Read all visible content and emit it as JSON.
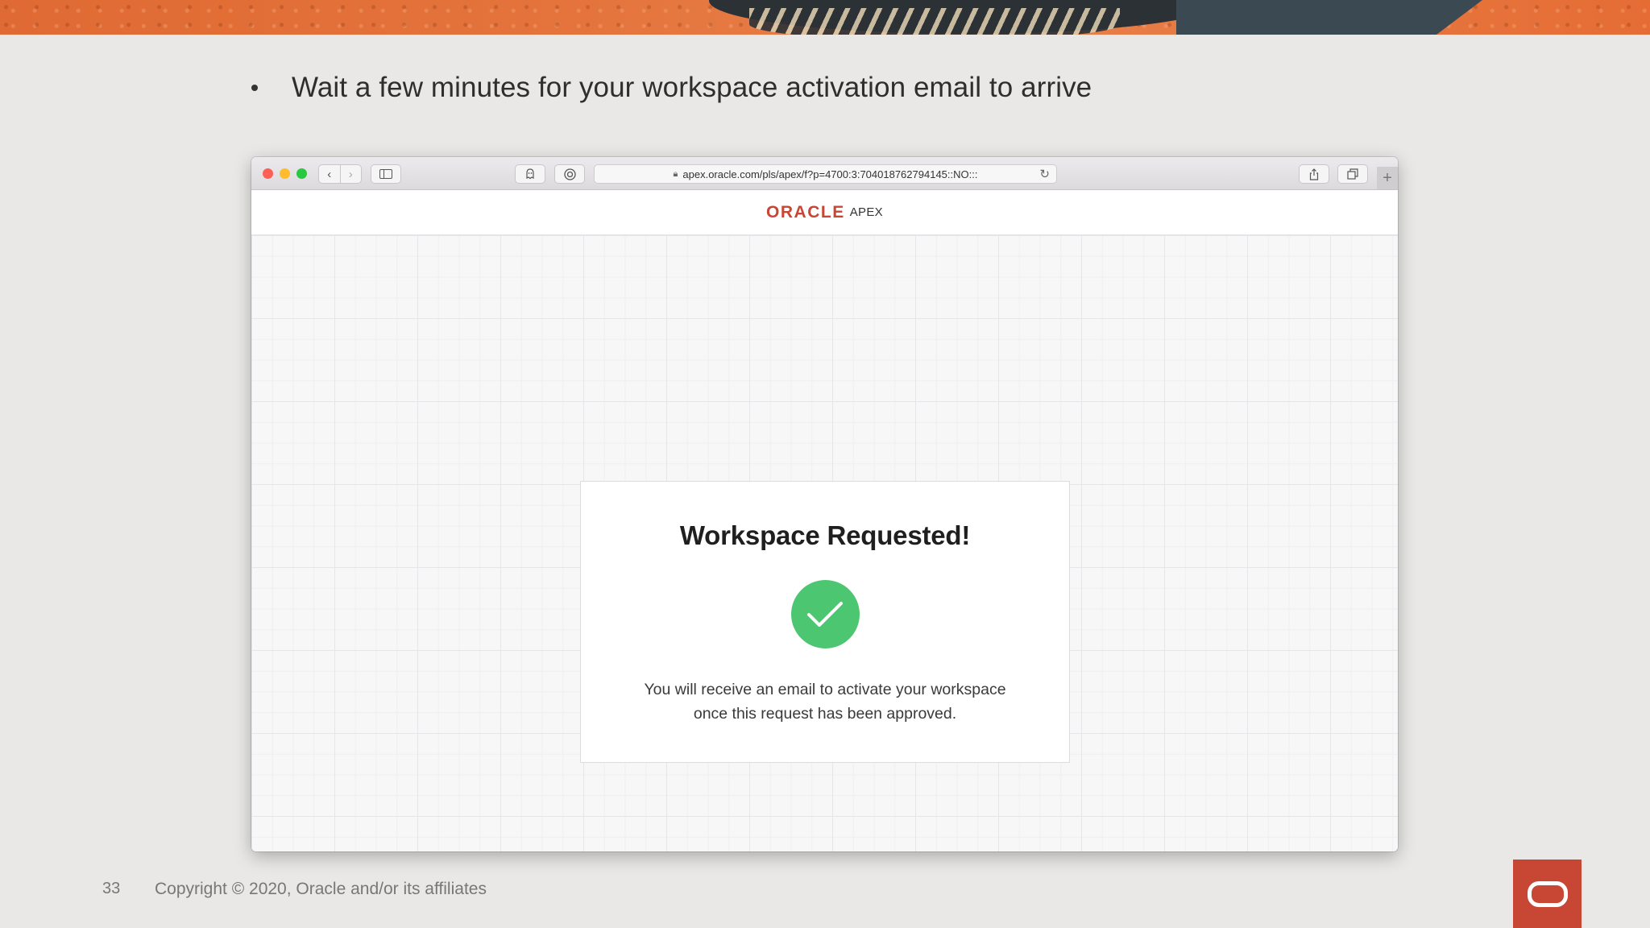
{
  "slide": {
    "bullet_text": "Wait a few minutes for your workspace activation email to arrive",
    "page_number": "33",
    "copyright": "Copyright © 2020, Oracle and/or its affiliates"
  },
  "browser": {
    "url": "apex.oracle.com/pls/apex/f?p=4700:3:704018762794145::NO:::",
    "new_tab_glyph": "+"
  },
  "app": {
    "brand": "ORACLE",
    "product": "APEX"
  },
  "card": {
    "title": "Workspace Requested!",
    "message_line1": "You will receive an email to activate your workspace",
    "message_line2": "once this request has been approved."
  },
  "colors": {
    "oracle_red": "#c74634",
    "success_green": "#4dc671"
  },
  "icons": [
    "back-arrow-icon",
    "forward-arrow-icon",
    "sidebar-icon",
    "privacy-icon",
    "extension-icon",
    "lock-icon",
    "reload-icon",
    "share-icon",
    "tabs-icon",
    "checkmark-icon",
    "oracle-logo-icon"
  ]
}
